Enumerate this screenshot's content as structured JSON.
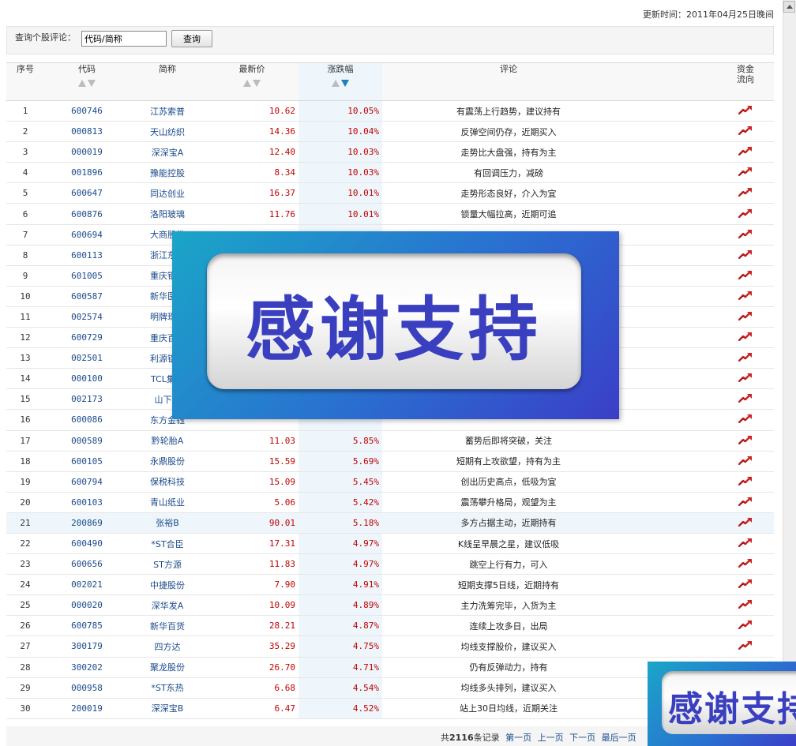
{
  "header": {
    "update_time": "更新时间：2011年04月25日晚间"
  },
  "query": {
    "label": "查询个股评论：",
    "input_value": "代码/简称",
    "button_label": "查询"
  },
  "table": {
    "columns": {
      "index": "序号",
      "code": "代码",
      "name": "简称",
      "price": "最新价",
      "change": "涨跌幅",
      "comment": "评论",
      "flow_line1": "资金",
      "flow_line2": "流向"
    },
    "sorted_column": "change",
    "sort_direction": "desc",
    "rows": [
      {
        "idx": "1",
        "code": "600746",
        "name": "江苏索普",
        "price": "10.62",
        "change": "10.05%",
        "comment": "有震荡上行趋势，建议持有"
      },
      {
        "idx": "2",
        "code": "000813",
        "name": "天山纺织",
        "price": "14.36",
        "change": "10.04%",
        "comment": "反弹空间仍存，近期买入"
      },
      {
        "idx": "3",
        "code": "000019",
        "name": "深深宝A",
        "price": "12.40",
        "change": "10.03%",
        "comment": "走势比大盘强，持有为主"
      },
      {
        "idx": "4",
        "code": "001896",
        "name": "豫能控股",
        "price": "8.34",
        "change": "10.03%",
        "comment": "有回调压力，减磅"
      },
      {
        "idx": "5",
        "code": "600647",
        "name": "同达创业",
        "price": "16.37",
        "change": "10.01%",
        "comment": "走势形态良好，介入为宜"
      },
      {
        "idx": "6",
        "code": "600876",
        "name": "洛阳玻璃",
        "price": "11.76",
        "change": "10.01%",
        "comment": "锁量大幅拉高，近期可追"
      },
      {
        "idx": "7",
        "code": "600694",
        "name": "大商股份",
        "price": "",
        "change": "",
        "comment": ""
      },
      {
        "idx": "8",
        "code": "600113",
        "name": "浙江东日",
        "price": "",
        "change": "",
        "comment": ""
      },
      {
        "idx": "9",
        "code": "601005",
        "name": "重庆钢铁",
        "price": "",
        "change": "",
        "comment": ""
      },
      {
        "idx": "10",
        "code": "600587",
        "name": "新华医疗",
        "price": "",
        "change": "",
        "comment": ""
      },
      {
        "idx": "11",
        "code": "002574",
        "name": "明牌珠宝",
        "price": "",
        "change": "",
        "comment": ""
      },
      {
        "idx": "12",
        "code": "600729",
        "name": "重庆百货",
        "price": "",
        "change": "",
        "comment": ""
      },
      {
        "idx": "13",
        "code": "002501",
        "name": "利源铝业",
        "price": "",
        "change": "",
        "comment": ""
      },
      {
        "idx": "14",
        "code": "000100",
        "name": "TCL集团",
        "price": "",
        "change": "",
        "comment": ""
      },
      {
        "idx": "15",
        "code": "002173",
        "name": "山下湖",
        "price": "",
        "change": "",
        "comment": ""
      },
      {
        "idx": "16",
        "code": "600086",
        "name": "东方金钰",
        "price": "",
        "change": "",
        "comment": ""
      },
      {
        "idx": "17",
        "code": "000589",
        "name": "黔轮胎A",
        "price": "11.03",
        "change": "5.85%",
        "comment": "蓄势后即将突破，关注"
      },
      {
        "idx": "18",
        "code": "600105",
        "name": "永鼎股份",
        "price": "15.59",
        "change": "5.69%",
        "comment": "短期有上攻欲望，持有为主"
      },
      {
        "idx": "19",
        "code": "600794",
        "name": "保税科技",
        "price": "15.09",
        "change": "5.45%",
        "comment": "创出历史高点，低吸为宜"
      },
      {
        "idx": "20",
        "code": "600103",
        "name": "青山纸业",
        "price": "5.06",
        "change": "5.42%",
        "comment": "震荡攀升格局，观望为主"
      },
      {
        "idx": "21",
        "code": "200869",
        "name": "张裕B",
        "price": "90.01",
        "change": "5.18%",
        "comment": "多方占据主动，近期持有"
      },
      {
        "idx": "22",
        "code": "600490",
        "name": "*ST合臣",
        "price": "17.31",
        "change": "4.97%",
        "comment": "K线呈早晨之星，建议低吸"
      },
      {
        "idx": "23",
        "code": "600656",
        "name": "ST方源",
        "price": "11.83",
        "change": "4.97%",
        "comment": "跳空上行有力，可入"
      },
      {
        "idx": "24",
        "code": "002021",
        "name": "中捷股份",
        "price": "7.90",
        "change": "4.91%",
        "comment": "短期支撑5日线，近期持有"
      },
      {
        "idx": "25",
        "code": "000020",
        "name": "深华发A",
        "price": "10.09",
        "change": "4.89%",
        "comment": "主力洗筹完毕，入货为主"
      },
      {
        "idx": "26",
        "code": "600785",
        "name": "新华百货",
        "price": "28.21",
        "change": "4.87%",
        "comment": "连续上攻多日，出局"
      },
      {
        "idx": "27",
        "code": "300179",
        "name": "四方达",
        "price": "35.29",
        "change": "4.75%",
        "comment": "均线支撑股价，建议买入"
      },
      {
        "idx": "28",
        "code": "300202",
        "name": "聚龙股份",
        "price": "26.70",
        "change": "4.71%",
        "comment": "仍有反弹动力，持有"
      },
      {
        "idx": "29",
        "code": "000958",
        "name": "*ST东热",
        "price": "6.68",
        "change": "4.54%",
        "comment": "均线多头排列，建议买入"
      },
      {
        "idx": "30",
        "code": "200019",
        "name": "深深宝B",
        "price": "6.47",
        "change": "4.52%",
        "comment": "站上30日均线，近期关注"
      }
    ],
    "highlighted_row": 21
  },
  "pager": {
    "prefix": "共",
    "total": "2116",
    "suffix": "条记录",
    "first": "第一页",
    "prev": "上一页",
    "next": "下一页",
    "last": "最后一页"
  },
  "overlay": {
    "banner_text": "感谢支持",
    "banner_partial_text": "感谢支持"
  },
  "colors": {
    "up": "#c00000",
    "link": "#1a4a8c",
    "sorted_bg": "#eef6fc",
    "flow_icon": "#cc2222"
  }
}
